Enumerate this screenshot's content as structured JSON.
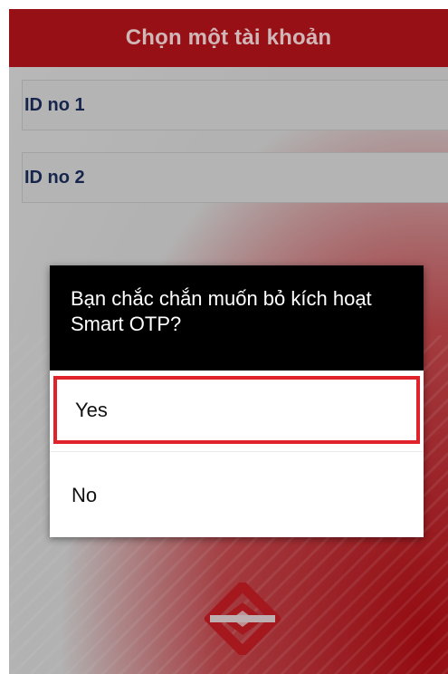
{
  "header": {
    "title": "Chọn một tài khoản"
  },
  "accounts": [
    {
      "label": "ID no 1"
    },
    {
      "label": "ID no 2"
    }
  ],
  "dialog": {
    "message": "Bạn chắc chắn muốn bỏ kích hoạt Smart OTP?",
    "options": [
      {
        "label": "Yes",
        "highlighted": true
      },
      {
        "label": "No",
        "highlighted": false
      }
    ]
  },
  "colors": {
    "brand_red": "#b8141c",
    "highlight_border": "#e0232b",
    "account_text": "#1c2e5c"
  },
  "icons": {
    "logo": "bank-logo-icon"
  }
}
